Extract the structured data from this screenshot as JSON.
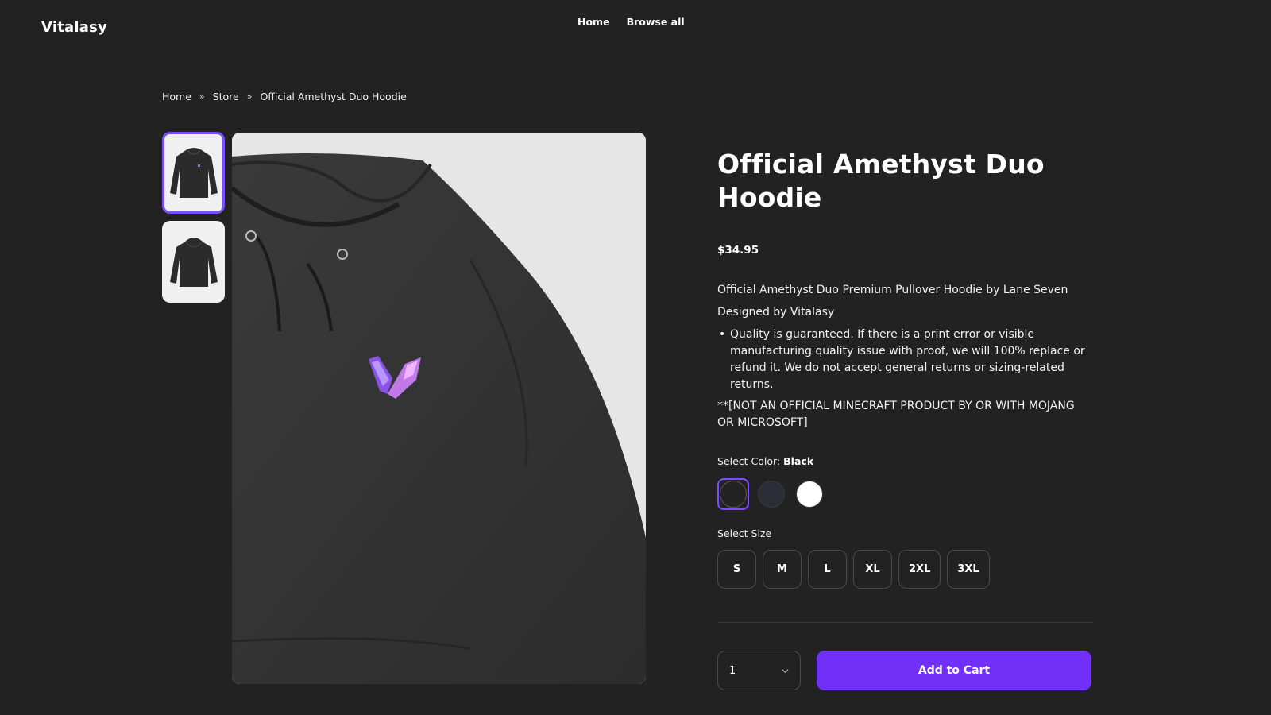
{
  "header": {
    "brand": "Vitalasy",
    "nav": [
      {
        "label": "Home"
      },
      {
        "label": "Browse all"
      }
    ]
  },
  "breadcrumb": {
    "items": [
      "Home",
      "Store",
      "Official Amethyst Duo Hoodie"
    ],
    "separator": "»"
  },
  "gallery": {
    "thumbnails": [
      {
        "alt": "hoodie-front",
        "selected": true
      },
      {
        "alt": "hoodie-back",
        "selected": false
      }
    ],
    "main_image": "hoodie-front"
  },
  "product": {
    "title": "Official Amethyst Duo Hoodie",
    "price": "$34.95",
    "description": {
      "line1": "Official Amethyst Duo Premium Pullover Hoodie by Lane Seven",
      "line2": "Designed by Vitalasy",
      "bullets": [
        "Quality is guaranteed. If there is a print error or visible manufacturing quality issue with proof, we will 100% replace or refund it. We do not accept general returns or sizing-related returns."
      ],
      "disclaimer": "**[NOT AN OFFICIAL MINECRAFT PRODUCT BY OR WITH MOJANG OR MICROSOFT]"
    },
    "color": {
      "label": "Select Color:",
      "selected": "Black",
      "options": [
        {
          "name": "Black",
          "hex": "#232223"
        },
        {
          "name": "Navy",
          "hex": "#2a2d36"
        },
        {
          "name": "White",
          "hex": "#ffffff"
        }
      ]
    },
    "size": {
      "label": "Select Size",
      "options": [
        "S",
        "M",
        "L",
        "XL",
        "2XL",
        "3XL"
      ]
    },
    "quantity": "1",
    "add_to_cart": "Add to Cart"
  },
  "colors": {
    "background": "#232223",
    "accent": "#7130f8",
    "selected_border": "#7c4dff"
  }
}
